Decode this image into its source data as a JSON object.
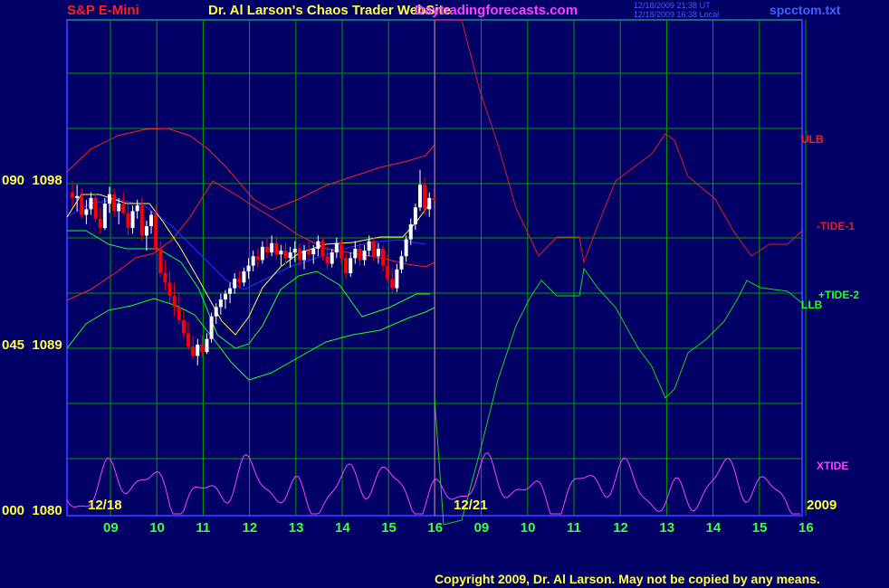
{
  "header": {
    "symbol": "S&P E-Mini",
    "title": "Dr. Al Larson's Chaos Trader WebSite",
    "website": "Daytradingforecasts.com",
    "timestamp_ut": "12/18/2009 21:38 UT",
    "timestamp_local": "12/18/2009 16:38 Local",
    "filename": "spcctom.txt"
  },
  "footer": {
    "copyright": "Copyright 2009, Dr. Al Larson. May not be copied by any means."
  },
  "colors": {
    "background": "#000066",
    "grid": "#00a000",
    "frame": "#3030ff",
    "candle_up": "#ffffff",
    "candle_down": "#ff0000",
    "ulb": "#ff2020",
    "llb": "#20ff20",
    "tide1": "#e02020",
    "tide2": "#20d020",
    "xtide": "#ff40ff",
    "average": "#3030ff",
    "fast_avg": "#ffff40",
    "date_text": "#ffff40",
    "hour_text": "#40ff40",
    "title_text": "#ffff40",
    "symbol_text": "#ff2020",
    "website_text": "#ff40ff",
    "copyright_text": "#ffff40"
  },
  "chart_data": {
    "type": "line",
    "title": "S&P E-Mini",
    "y_axis": {
      "ticks": [
        {
          "label": "090  1098",
          "value": 1098
        },
        {
          "label": "045  1089",
          "value": 1089
        },
        {
          "label": "000  1080",
          "value": 1080
        }
      ],
      "ylim": [
        1080,
        1098
      ],
      "grid": true
    },
    "x_axis": {
      "hour_labels": [
        "09",
        "10",
        "11",
        "12",
        "13",
        "14",
        "15",
        "16",
        "09",
        "10",
        "11",
        "12",
        "13",
        "14",
        "15",
        "16"
      ],
      "date_labels": [
        {
          "label": "12/18",
          "at_hour": "09",
          "day": 0
        },
        {
          "label": "12/21",
          "at_hour": "09",
          "day": 1
        }
      ],
      "year_label": "2009",
      "grid": true
    },
    "series_labels": [
      {
        "name": "ULB",
        "color": "#ff2020"
      },
      {
        "name": "-TIDE-1",
        "color": "#e02020"
      },
      {
        "name": "+TIDE-2",
        "color": "#20ff20"
      },
      {
        "name": "LLB",
        "color": "#20ff20"
      },
      {
        "name": "XTIDE",
        "color": "#ff40ff"
      }
    ],
    "candles": {
      "note": "Intraday bars for 12/18 session; hour positions 0-8 correspond to 08:30-16:15",
      "points": [
        [
          0.0,
          1097.2,
          1097.8,
          1096.4,
          1096.9
        ],
        [
          0.1,
          1096.9,
          1097.6,
          1096.2,
          1097.0
        ],
        [
          0.2,
          1097.0,
          1097.4,
          1095.8,
          1096.0
        ],
        [
          0.3,
          1096.0,
          1096.8,
          1095.5,
          1096.3
        ],
        [
          0.4,
          1096.3,
          1097.2,
          1096.0,
          1096.9
        ],
        [
          0.5,
          1096.9,
          1097.1,
          1095.6,
          1095.8
        ],
        [
          0.6,
          1095.8,
          1096.4,
          1095.0,
          1095.3
        ],
        [
          0.7,
          1095.3,
          1096.9,
          1095.2,
          1096.6
        ],
        [
          0.8,
          1096.6,
          1097.5,
          1096.1,
          1097.1
        ],
        [
          0.9,
          1097.1,
          1097.4,
          1095.9,
          1096.2
        ],
        [
          1.0,
          1096.2,
          1096.9,
          1095.5,
          1096.6
        ],
        [
          1.1,
          1096.6,
          1097.2,
          1096.0,
          1096.1
        ],
        [
          1.2,
          1096.1,
          1096.6,
          1094.9,
          1095.3
        ],
        [
          1.3,
          1095.3,
          1096.5,
          1095.0,
          1096.2
        ],
        [
          1.4,
          1096.2,
          1096.8,
          1095.8,
          1096.5
        ],
        [
          1.5,
          1096.5,
          1096.9,
          1094.6,
          1094.9
        ],
        [
          1.6,
          1094.9,
          1095.7,
          1094.1,
          1095.4
        ],
        [
          1.7,
          1095.4,
          1096.2,
          1095.0,
          1096.0
        ],
        [
          1.8,
          1096.0,
          1096.5,
          1094.0,
          1094.2
        ],
        [
          1.9,
          1094.2,
          1094.6,
          1092.7,
          1092.9
        ],
        [
          2.0,
          1092.9,
          1093.6,
          1092.0,
          1092.4
        ],
        [
          2.1,
          1092.4,
          1093.0,
          1091.3,
          1091.7
        ],
        [
          2.2,
          1091.7,
          1092.4,
          1090.6,
          1091.1
        ],
        [
          2.3,
          1091.1,
          1091.9,
          1090.2,
          1090.4
        ],
        [
          2.4,
          1090.4,
          1090.9,
          1089.5,
          1089.7
        ],
        [
          2.5,
          1089.7,
          1090.3,
          1088.8,
          1089.0
        ],
        [
          2.6,
          1089.0,
          1089.6,
          1088.3,
          1088.5
        ],
        [
          2.7,
          1088.5,
          1089.4,
          1088.0,
          1089.1
        ],
        [
          2.8,
          1089.1,
          1089.6,
          1088.4,
          1088.7
        ],
        [
          2.9,
          1088.7,
          1089.7,
          1088.6,
          1089.4
        ],
        [
          3.0,
          1089.4,
          1090.8,
          1089.2,
          1090.6
        ],
        [
          3.1,
          1090.6,
          1091.3,
          1090.2,
          1091.1
        ],
        [
          3.2,
          1091.1,
          1091.8,
          1090.7,
          1091.5
        ],
        [
          3.3,
          1091.5,
          1092.0,
          1091.0,
          1091.8
        ],
        [
          3.4,
          1091.8,
          1092.4,
          1091.3,
          1092.1
        ],
        [
          3.5,
          1092.1,
          1092.9,
          1091.8,
          1092.6
        ],
        [
          3.6,
          1092.6,
          1093.0,
          1092.1,
          1092.4
        ],
        [
          3.7,
          1092.4,
          1093.2,
          1092.2,
          1093.0
        ],
        [
          3.8,
          1093.0,
          1093.7,
          1092.6,
          1093.3
        ],
        [
          3.9,
          1093.3,
          1094.1,
          1093.0,
          1093.8
        ],
        [
          4.0,
          1093.8,
          1094.2,
          1093.2,
          1093.6
        ],
        [
          4.1,
          1093.6,
          1094.6,
          1093.4,
          1094.3
        ],
        [
          4.2,
          1094.3,
          1094.8,
          1093.7,
          1094.0
        ],
        [
          4.3,
          1094.0,
          1094.9,
          1093.8,
          1094.5
        ],
        [
          4.4,
          1094.5,
          1094.9,
          1093.6,
          1093.9
        ],
        [
          4.5,
          1093.9,
          1094.4,
          1093.3,
          1094.1
        ],
        [
          4.6,
          1094.1,
          1094.5,
          1093.4,
          1093.7
        ],
        [
          4.7,
          1093.7,
          1094.3,
          1093.2,
          1094.0
        ],
        [
          4.8,
          1094.0,
          1094.6,
          1093.5,
          1094.2
        ],
        [
          4.9,
          1094.2,
          1094.5,
          1093.3,
          1093.6
        ],
        [
          5.0,
          1093.6,
          1094.4,
          1093.1,
          1094.1
        ],
        [
          5.1,
          1094.1,
          1094.6,
          1093.6,
          1093.9
        ],
        [
          5.2,
          1093.9,
          1094.4,
          1093.4,
          1094.2
        ],
        [
          5.3,
          1094.2,
          1094.9,
          1093.8,
          1094.6
        ],
        [
          5.4,
          1094.6,
          1094.8,
          1093.6,
          1093.8
        ],
        [
          5.5,
          1093.8,
          1094.3,
          1093.1,
          1093.4
        ],
        [
          5.6,
          1093.4,
          1094.2,
          1093.2,
          1094.0
        ],
        [
          5.7,
          1094.0,
          1094.8,
          1093.7,
          1094.5
        ],
        [
          5.8,
          1094.5,
          1094.7,
          1093.4,
          1093.7
        ],
        [
          5.9,
          1093.7,
          1093.9,
          1092.6,
          1092.9
        ],
        [
          6.0,
          1092.9,
          1094.0,
          1092.7,
          1093.7
        ],
        [
          6.1,
          1093.7,
          1094.6,
          1093.4,
          1094.2
        ],
        [
          6.2,
          1094.2,
          1094.5,
          1093.3,
          1093.6
        ],
        [
          6.3,
          1093.6,
          1094.4,
          1093.3,
          1094.1
        ],
        [
          6.4,
          1094.1,
          1094.9,
          1093.8,
          1094.6
        ],
        [
          6.5,
          1094.6,
          1094.8,
          1093.5,
          1093.8
        ],
        [
          6.6,
          1093.8,
          1094.5,
          1093.4,
          1094.2
        ],
        [
          6.7,
          1094.2,
          1094.4,
          1093.0,
          1093.3
        ],
        [
          6.8,
          1093.3,
          1093.9,
          1092.4,
          1092.6
        ],
        [
          6.9,
          1092.6,
          1093.2,
          1091.8,
          1092.1
        ],
        [
          7.0,
          1092.1,
          1093.4,
          1091.9,
          1093.1
        ],
        [
          7.1,
          1093.1,
          1094.1,
          1092.9,
          1093.8
        ],
        [
          7.2,
          1093.8,
          1094.9,
          1093.5,
          1094.7
        ],
        [
          7.3,
          1094.7,
          1095.8,
          1094.4,
          1095.5
        ],
        [
          7.4,
          1095.5,
          1096.6,
          1095.2,
          1096.4
        ],
        [
          7.5,
          1096.4,
          1098.4,
          1096.2,
          1097.6
        ],
        [
          7.6,
          1097.6,
          1098.0,
          1096.0,
          1096.3
        ],
        [
          7.7,
          1096.3,
          1097.2,
          1095.9,
          1096.9
        ],
        [
          7.8,
          1096.9,
          1097.4,
          1096.4,
          1096.8
        ]
      ]
    }
  }
}
